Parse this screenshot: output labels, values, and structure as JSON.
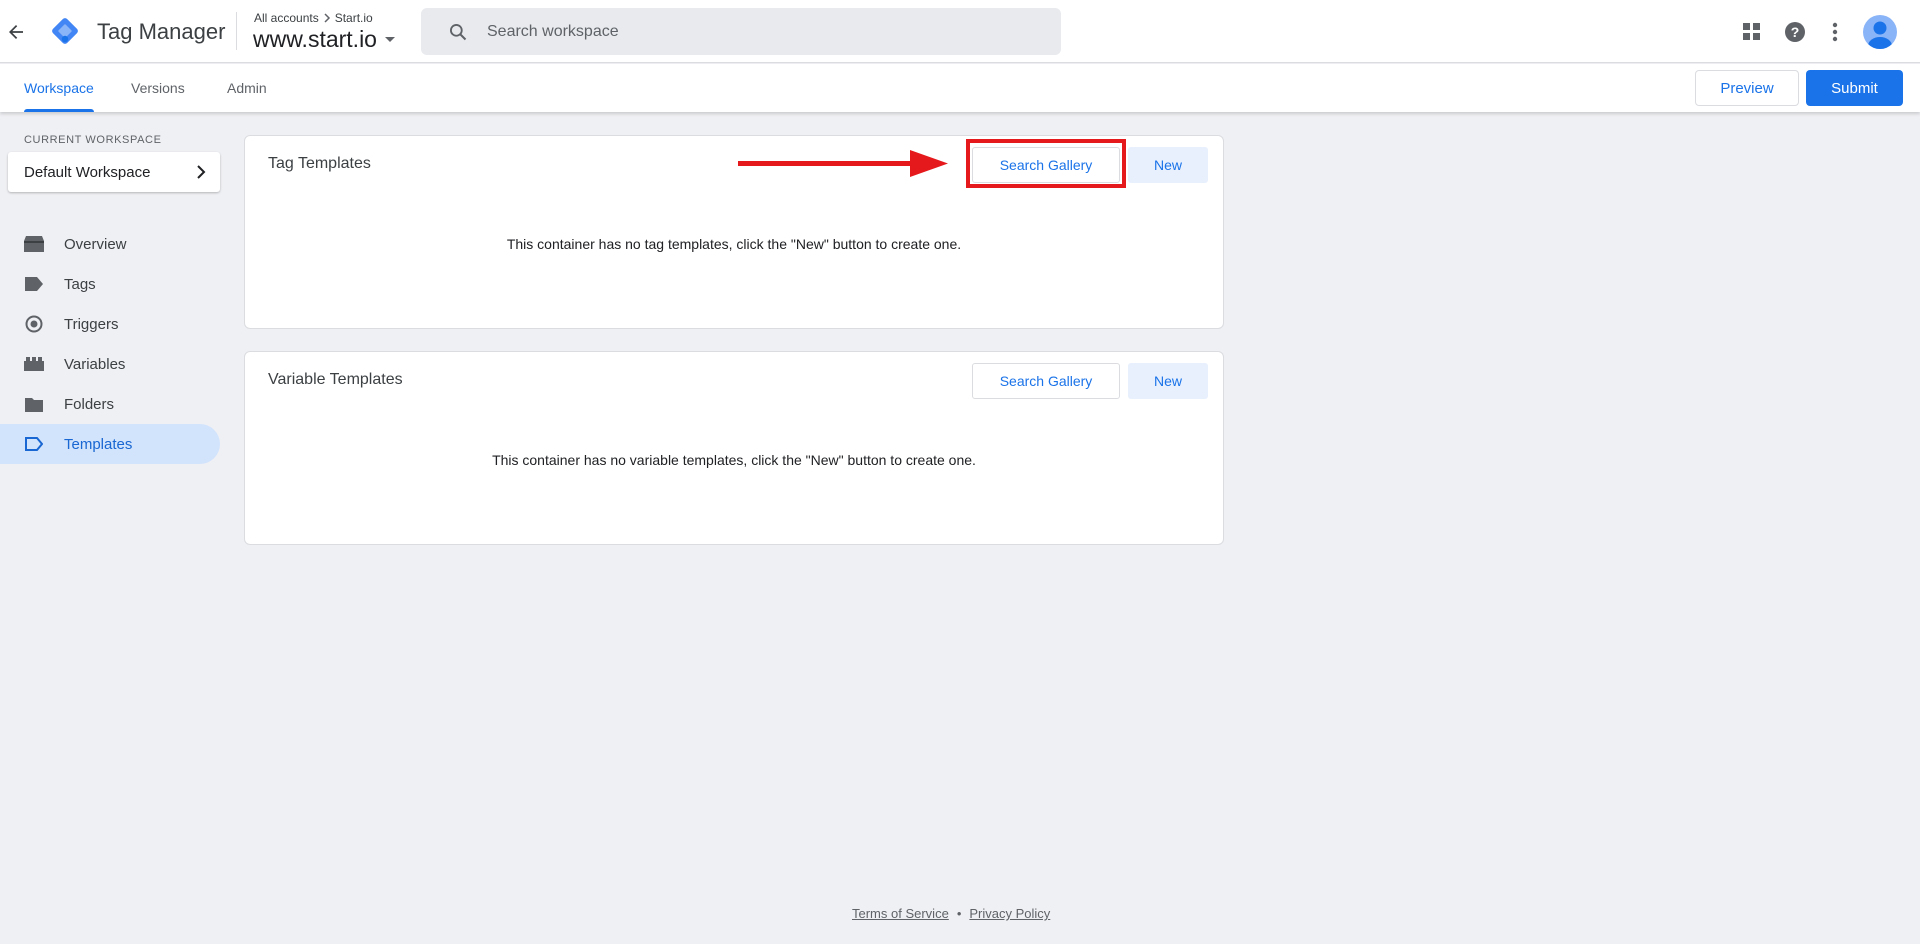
{
  "header": {
    "app_title": "Tag Manager",
    "account_crumb": "All accounts",
    "account_name": "Start.io",
    "container_name": "www.start.io",
    "search_placeholder": "Search workspace"
  },
  "subnav": {
    "tabs": [
      {
        "label": "Workspace",
        "active": true
      },
      {
        "label": "Versions",
        "active": false
      },
      {
        "label": "Admin",
        "active": false
      }
    ],
    "preview_label": "Preview",
    "submit_label": "Submit"
  },
  "sidebar": {
    "current_workspace_label": "CURRENT WORKSPACE",
    "workspace_name": "Default Workspace",
    "items": [
      {
        "label": "Overview",
        "icon": "overview-icon"
      },
      {
        "label": "Tags",
        "icon": "tag-icon"
      },
      {
        "label": "Triggers",
        "icon": "trigger-icon"
      },
      {
        "label": "Variables",
        "icon": "variables-icon"
      },
      {
        "label": "Folders",
        "icon": "folder-icon"
      },
      {
        "label": "Templates",
        "icon": "template-icon",
        "active": true
      }
    ]
  },
  "tag_templates": {
    "title": "Tag Templates",
    "gallery_label": "Search Gallery",
    "new_label": "New",
    "empty_message": "This container has no tag templates, click the \"New\" button to create one."
  },
  "variable_templates": {
    "title": "Variable Templates",
    "gallery_label": "Search Gallery",
    "new_label": "New",
    "empty_message": "This container has no variable templates, click the \"New\" button to create one."
  },
  "footer": {
    "terms": "Terms of Service",
    "separator": "•",
    "privacy": "Privacy Policy"
  },
  "colors": {
    "accent": "#1a73e8",
    "annotation": "#e5191c",
    "background": "#eff0f3"
  }
}
